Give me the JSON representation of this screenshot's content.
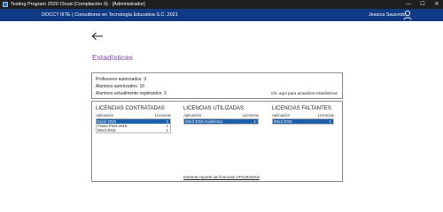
{
  "window": {
    "title": "Testing Program 2020 Cloud (Compilación 0) - [Administrador]",
    "minimize": "—",
    "maximize": "☐",
    "close": "✕"
  },
  "header": {
    "org": "DOCCT 0ITE | Consultores en Tecnología Educativa S.C. 2021",
    "user_name": "Jessica Saucedo",
    "bg_color": "#103a83"
  },
  "page": {
    "title": "Estadísticas",
    "title_color": "#7a3ea8"
  },
  "info": {
    "teachers": "Profesores autorizados: 3",
    "students_auth": "Alumnos autorizados: 10",
    "students_reg": "Alumnos actualmente registrados: 3",
    "refresh_link": "Clic aquí para actualizar estadísticas"
  },
  "licenses": {
    "contracted": {
      "title": "LICENCIAS  CONTRATADAS",
      "col_app": "Aplicación",
      "col_lic": "Licencias",
      "rows": [
        {
          "name": "Excel 2019",
          "count": "1"
        },
        {
          "name": "Power Point 2019",
          "count": "1"
        },
        {
          "name": "Word 2019",
          "count": "1"
        }
      ]
    },
    "used": {
      "title": "LICENCIAS UTILIZADAS",
      "col_app": "Aplicación",
      "col_lic": "Licencias",
      "rows": [
        {
          "name": "Word 2019 Académico",
          "count": "1"
        }
      ]
    },
    "missing": {
      "title": "LICENCIAS FALTANTES",
      "col_app": "Aplicación",
      "col_lic": "Licencias",
      "rows": [
        {
          "name": "Word 2019",
          "count": "1"
        }
      ]
    },
    "report_link": "Generar reporte de licencias UTILIZADAS"
  },
  "selection_color": "#1b5faa",
  "icons": {
    "app": "app-icon",
    "back": "arrow-left-icon",
    "user": "user-icon"
  }
}
